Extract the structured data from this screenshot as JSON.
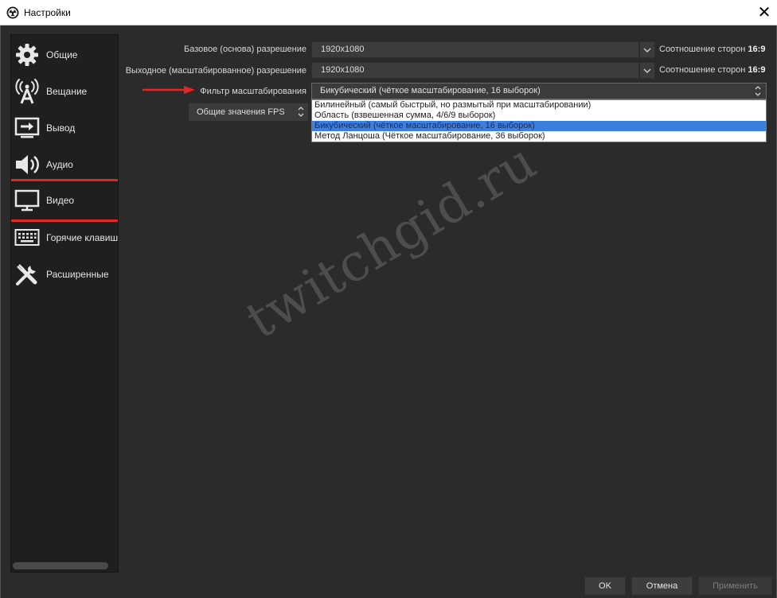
{
  "window": {
    "title": "Настройки",
    "close": "✕"
  },
  "sidebar": {
    "items": [
      {
        "label": "Общие",
        "icon": "gear-icon"
      },
      {
        "label": "Вещание",
        "icon": "broadcast-icon"
      },
      {
        "label": "Вывод",
        "icon": "output-icon"
      },
      {
        "label": "Аудио",
        "icon": "speaker-icon"
      },
      {
        "label": "Видео",
        "icon": "monitor-icon"
      },
      {
        "label": "Горячие клавиш",
        "icon": "keyboard-icon"
      },
      {
        "label": "Расширенные",
        "icon": "tools-icon"
      }
    ],
    "highlighted": "Видео"
  },
  "video": {
    "base_resolution_label": "Базовое (основа) разрешение",
    "base_resolution_value": "1920x1080",
    "base_ratio_label": "Соотношение сторон",
    "base_ratio_value": "16:9",
    "output_resolution_label": "Выходное (масштабированное) разрешение",
    "output_resolution_value": "1920x1080",
    "output_ratio_label": "Соотношение сторон",
    "output_ratio_value": "16:9",
    "scale_filter_label": "Фильтр масштабирования",
    "scale_filter_value": "Бикубический (чёткое масштабирование, 16 выборок)",
    "scale_filter_options": [
      "Билинейный (самый быстрый, но размытый при масштабировании)",
      "Область (взвешенная сумма, 4/6/9 выборок)",
      "Бикубический (чёткое масштабирование, 16 выборок)",
      "Метод Ланцоша (Чёткое масштабирование, 36 выборок)"
    ],
    "scale_filter_selected_index": 2,
    "fps_type_value": "Общие значения FPS"
  },
  "watermark": "twitchgid.ru",
  "buttons": {
    "ok": "OK",
    "cancel": "Отмена",
    "apply": "Применить"
  },
  "colors": {
    "highlight_outline": "#e52424",
    "selection": "#3d7fde",
    "arrow": "#e52424"
  }
}
